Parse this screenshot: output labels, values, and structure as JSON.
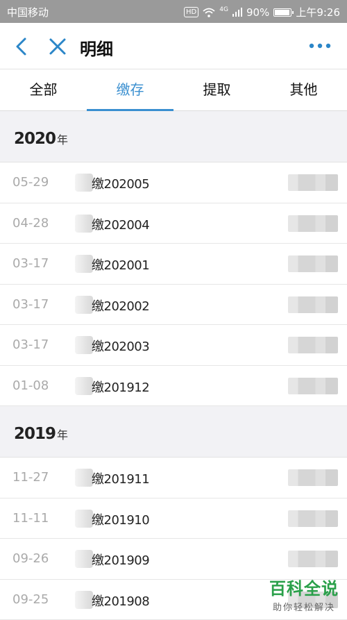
{
  "status_bar": {
    "carrier": "中国移动",
    "hd": "HD",
    "network": "4G",
    "battery": "90%",
    "time": "上午9:26"
  },
  "header": {
    "title": "明细",
    "back_icon": "back-chevron-icon",
    "close_icon": "close-icon",
    "more_icon": "more-dots-icon",
    "accent": "#2b86c8"
  },
  "tabs": [
    {
      "label": "全部",
      "active": false
    },
    {
      "label": "缴存",
      "active": true
    },
    {
      "label": "提取",
      "active": false
    },
    {
      "label": "其他",
      "active": false
    }
  ],
  "groups": [
    {
      "year": "2020",
      "unit": "年",
      "rows": [
        {
          "date": "05-29",
          "desc": "缴202005"
        },
        {
          "date": "04-28",
          "desc": "缴202004"
        },
        {
          "date": "03-17",
          "desc": "缴202001"
        },
        {
          "date": "03-17",
          "desc": "缴202002"
        },
        {
          "date": "03-17",
          "desc": "缴202003"
        },
        {
          "date": "01-08",
          "desc": "缴201912"
        }
      ]
    },
    {
      "year": "2019",
      "unit": "年",
      "rows": [
        {
          "date": "11-27",
          "desc": "缴201911"
        },
        {
          "date": "11-11",
          "desc": "缴201910"
        },
        {
          "date": "09-26",
          "desc": "缴201909"
        },
        {
          "date": "09-25",
          "desc": "缴201908"
        }
      ]
    }
  ],
  "watermark": {
    "title": "百科全说",
    "subtitle": "助你轻松解决"
  }
}
